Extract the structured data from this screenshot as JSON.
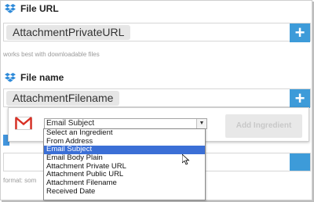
{
  "file_url": {
    "label": "File URL",
    "token": "AttachmentPrivateURL",
    "add_symbol": "+",
    "hint": "works best with downloadable files"
  },
  "file_name": {
    "label": "File name",
    "token": "AttachmentFilename",
    "add_symbol": "+"
  },
  "ingredient_picker": {
    "selected": "Email Subject",
    "add_button_label": "Add Ingredient",
    "options": [
      "Select an Ingredient",
      "From Address",
      "Email Subject",
      "Email Body Plain",
      "Attachment Private URL",
      "Attachment Public URL",
      "Attachment Filename",
      "Received Date"
    ],
    "selected_index": 2
  },
  "obscured_field": {
    "hint": "format: som"
  },
  "colors": {
    "accent_blue": "#3d9bd9",
    "selection_blue": "#3b6fd6",
    "gmail_red": "#d93025"
  },
  "icons": {
    "dropbox": "dropbox-icon",
    "gmail": "gmail-icon",
    "plus": "plus-icon",
    "cursor": "mouse-cursor-icon"
  }
}
